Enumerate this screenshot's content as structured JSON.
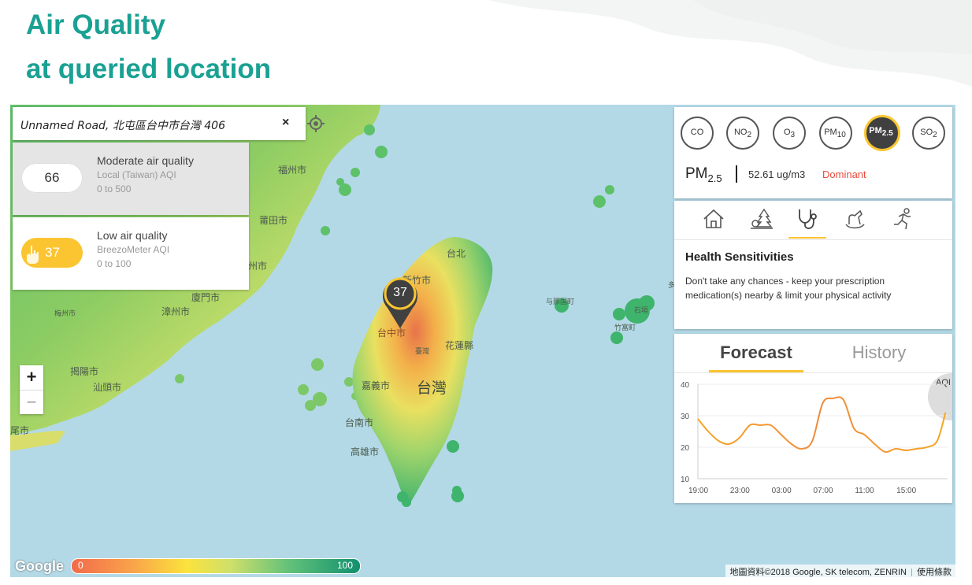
{
  "header": {
    "line1": "Air Quality",
    "line2": "at queried location"
  },
  "search": {
    "address": "Unnamed Road, 北屯區台中市台灣 406",
    "clear_glyph": "×"
  },
  "aqi_cards": [
    {
      "value": "66",
      "title": "Moderate air quality",
      "source": "Local (Taiwan) AQI",
      "range": "0 to 500"
    },
    {
      "value": "37",
      "title": "Low air quality",
      "source": "BreezoMeter AQI",
      "range": "0 to 100"
    }
  ],
  "zoom": {
    "in": "+",
    "out": "−"
  },
  "marker": {
    "value": "37"
  },
  "map_places": {
    "fuzhou": "福州市",
    "putian": "莆田市",
    "quanzhou": "泉州市",
    "xiamen": "廈門市",
    "zhangzhou": "漳州市",
    "meizhou": "梅州市",
    "jieyang": "揭陽市",
    "shantou": "汕頭市",
    "wei": "尾市",
    "taipei": "台北",
    "hsinchu": "新竹市",
    "taichung": "台中市",
    "taiwan_small": "臺灣",
    "hualien": "花蓮縣",
    "chiayi": "嘉義市",
    "taiwan": "台灣",
    "tainan": "台南市",
    "kaohsiung": "高雄市",
    "yonaguni": "与那国町",
    "ishigaki": "石垣",
    "taketomi": "竹富町",
    "tarama": "多"
  },
  "scale": {
    "min": "0",
    "max": "100"
  },
  "google_logo": "Google",
  "attribution": {
    "data": "地圖資料©2018 Google, SK telecom, ZENRIN",
    "terms": "使用條款"
  },
  "pollutants": [
    {
      "base": "CO",
      "sub": ""
    },
    {
      "base": "NO",
      "sub": "2"
    },
    {
      "base": "O",
      "sub": "3"
    },
    {
      "base": "PM",
      "sub": "10"
    },
    {
      "base": "PM",
      "sub": "2.5",
      "active": true
    },
    {
      "base": "SO",
      "sub": "2"
    }
  ],
  "readout": {
    "name": "PM",
    "sub": "2.5",
    "value": "52.61 ug/m3",
    "status": "Dominant"
  },
  "health": {
    "tab_icons": [
      "home-icon",
      "outdoors-icon",
      "stethoscope-icon",
      "child-icon",
      "sport-icon"
    ],
    "active_tab": "stethoscope-icon",
    "title": "Health Sensitivities",
    "text": "Don't take any chances - keep your prescription medication(s) nearby & limit your physical activity"
  },
  "forecast": {
    "tab_forecast": "Forecast",
    "tab_history": "History",
    "badge": "AQI",
    "active_color": "#fbc531"
  },
  "chart_data": {
    "type": "line",
    "y_ticks": [
      10,
      20,
      30,
      40
    ],
    "ylim": [
      10,
      40
    ],
    "x_tick_labels": [
      "19:00",
      "23:00",
      "03:00",
      "07:00",
      "11:00",
      "15:00"
    ],
    "x_hours": [
      0,
      4,
      8,
      12,
      16,
      20
    ],
    "series": [
      {
        "x": [
          0,
          1,
          2,
          3,
          4,
          5,
          6,
          7,
          8,
          9,
          10,
          11,
          12,
          13,
          14,
          15,
          16,
          17,
          18,
          19,
          20,
          21,
          22,
          23,
          23.8
        ],
        "values": [
          29,
          25,
          22,
          21,
          23,
          27,
          27,
          27,
          24,
          21,
          19.5,
          22,
          34,
          35.5,
          35,
          26,
          24,
          21,
          18.5,
          19.5,
          19,
          19.5,
          20,
          22,
          31
        ]
      }
    ],
    "line_gradient": [
      "#f5a623",
      "#f08a3c",
      "#f5a623"
    ]
  }
}
